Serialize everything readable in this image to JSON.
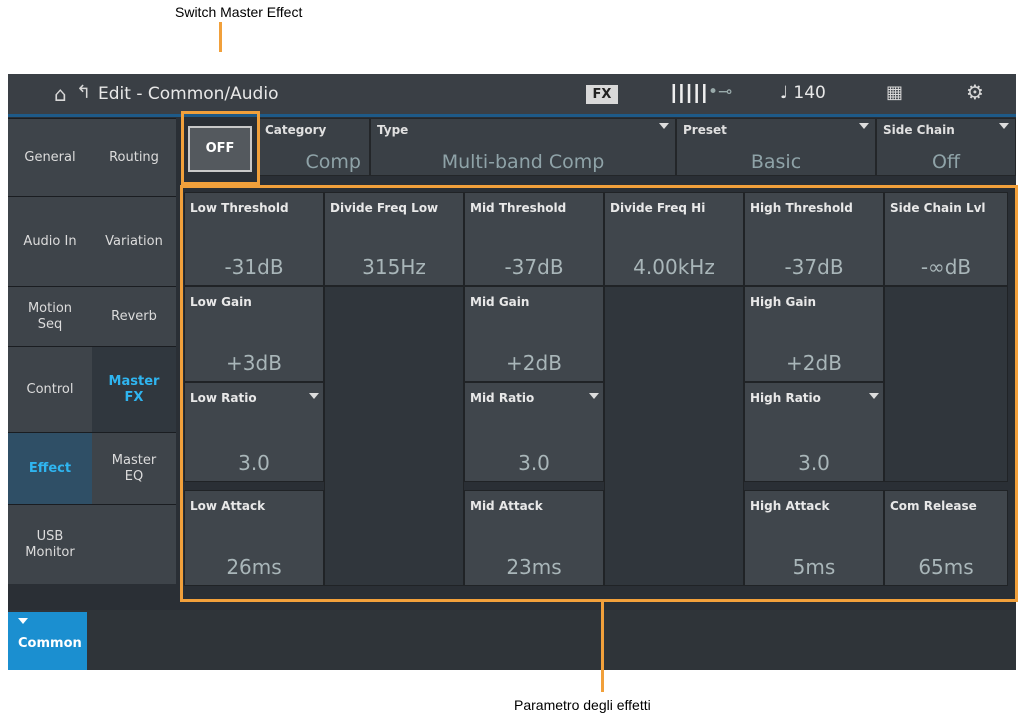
{
  "callouts": {
    "top": "Switch Master Effect",
    "bottom": "Parametro degli effetti"
  },
  "header": {
    "title": "Edit - Common/Audio",
    "fx_badge": "FX",
    "tempo": "♩ 140",
    "icons": [
      "home-icon",
      "back-icon",
      "keyboard-icon",
      "usb-icon",
      "grid-icon",
      "gear-icon"
    ]
  },
  "left_tabs": [
    "General",
    "Audio In",
    "Motion\nSeq",
    "Control",
    "Effect",
    "USB\nMonitor"
  ],
  "sub_tabs": [
    "Routing",
    "Variation",
    "Reverb",
    "Master\nFX",
    "Master\nEQ"
  ],
  "bottom_tab": "Common",
  "effect": {
    "switch_label": "OFF",
    "category": {
      "label": "Category",
      "value": "Comp"
    },
    "type": {
      "label": "Type",
      "value": "Multi-band Comp"
    },
    "preset": {
      "label": "Preset",
      "value": "Basic"
    },
    "side_chain": {
      "label": "Side Chain",
      "value": "Off"
    }
  },
  "params": [
    {
      "label": "Low Threshold",
      "value": "-31dB"
    },
    {
      "label": "Divide Freq Low",
      "value": "315Hz"
    },
    {
      "label": "Mid Threshold",
      "value": "-37dB"
    },
    {
      "label": "Divide Freq Hi",
      "value": "4.00kHz"
    },
    {
      "label": "High Threshold",
      "value": "-37dB"
    },
    {
      "label": "Side Chain Lvl",
      "value": "-∞dB"
    },
    {
      "label": "Low Gain",
      "value": "+3dB"
    },
    {
      "label": "Mid Gain",
      "value": "+2dB"
    },
    {
      "label": "High Gain",
      "value": "+2dB"
    },
    {
      "label": "Low Ratio",
      "value": "3.0"
    },
    {
      "label": "Mid Ratio",
      "value": "3.0"
    },
    {
      "label": "High Ratio",
      "value": "3.0"
    },
    {
      "label": "Low Attack",
      "value": "26ms"
    },
    {
      "label": "Mid Attack",
      "value": "23ms"
    },
    {
      "label": "High Attack",
      "value": "5ms"
    },
    {
      "label": "Com Release",
      "value": "65ms"
    }
  ]
}
